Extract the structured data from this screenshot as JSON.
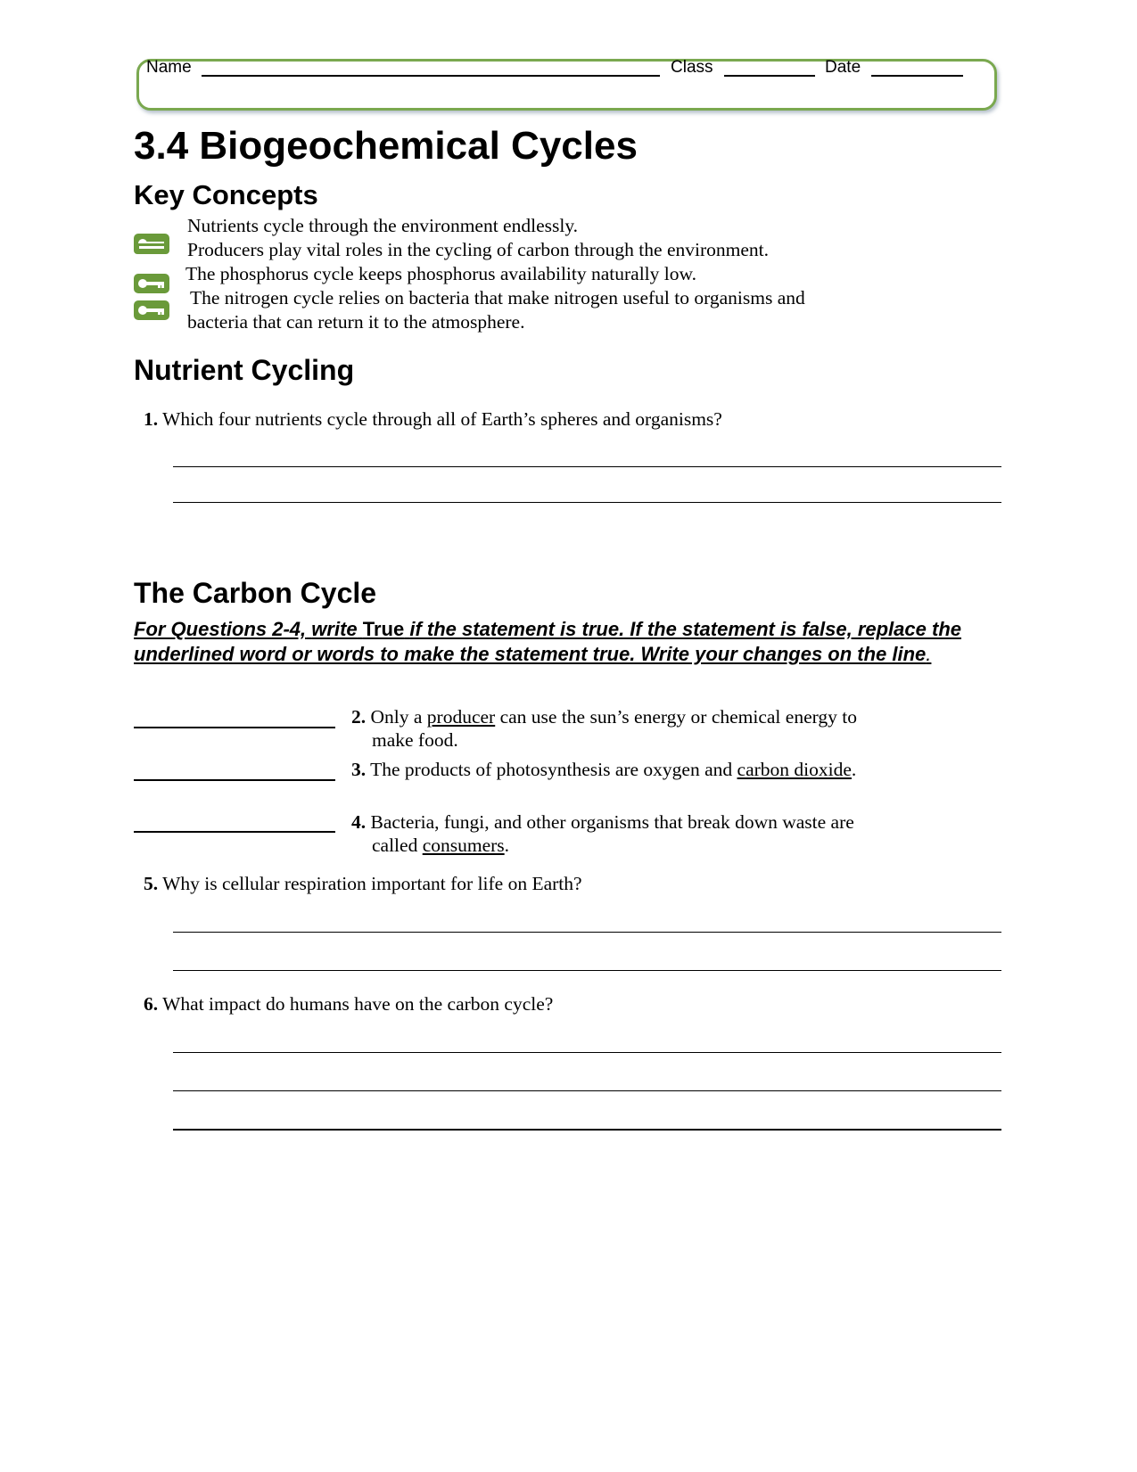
{
  "header": {
    "name_label": "Name",
    "class_label": "Class",
    "date_label": "Date",
    "accent_color": "#7aa84f"
  },
  "title": "3.4 Biogeochemical Cycles",
  "key_concepts": {
    "heading": "Key Concepts",
    "icon": "key-icon",
    "lines": [
      "Nutrients cycle through the environment endlessly.",
      "Producers play vital roles in the cycling of carbon through the environment.",
      "The phosphorus cycle keeps phosphorus availability naturally low.",
      "The nitrogen cycle relies on bacteria that make nitrogen useful to organisms and",
      "bacteria that can return it to the atmosphere."
    ]
  },
  "nutrient_cycling": {
    "heading": "Nutrient Cycling",
    "q1": {
      "number": "1.",
      "text": "Which four nutrients cycle through all of Earth’s spheres and organisms?"
    }
  },
  "carbon_cycle": {
    "heading": "The Carbon Cycle",
    "instructions": {
      "part1": "For Questions 2-4,",
      "part2": "write",
      "part3": "True",
      "part4": "if the statement is true. If the statement is false, replace the underlined word or words to make the statement true. Write your changes on the line",
      "part5": "."
    },
    "q2": {
      "number": "2.",
      "pre": "Only a ",
      "underlined": "producer",
      "post": " can use the sun’s energy or chemical energy to",
      "line2": "make food."
    },
    "q3": {
      "number": "3.",
      "pre": "The products of photosynthesis are oxygen and ",
      "underlined": "carbon dioxide",
      "post": "."
    },
    "q4": {
      "number": "4.",
      "line1": "Bacteria, fungi, and other organisms that break down waste are",
      "pre": "called ",
      "underlined": "consumers",
      "post": "."
    },
    "q5": {
      "number": "5.",
      "text": "Why is cellular respiration important for life on Earth?"
    },
    "q6": {
      "number": "6.",
      "text": "What impact do humans have on the carbon cycle?"
    }
  }
}
